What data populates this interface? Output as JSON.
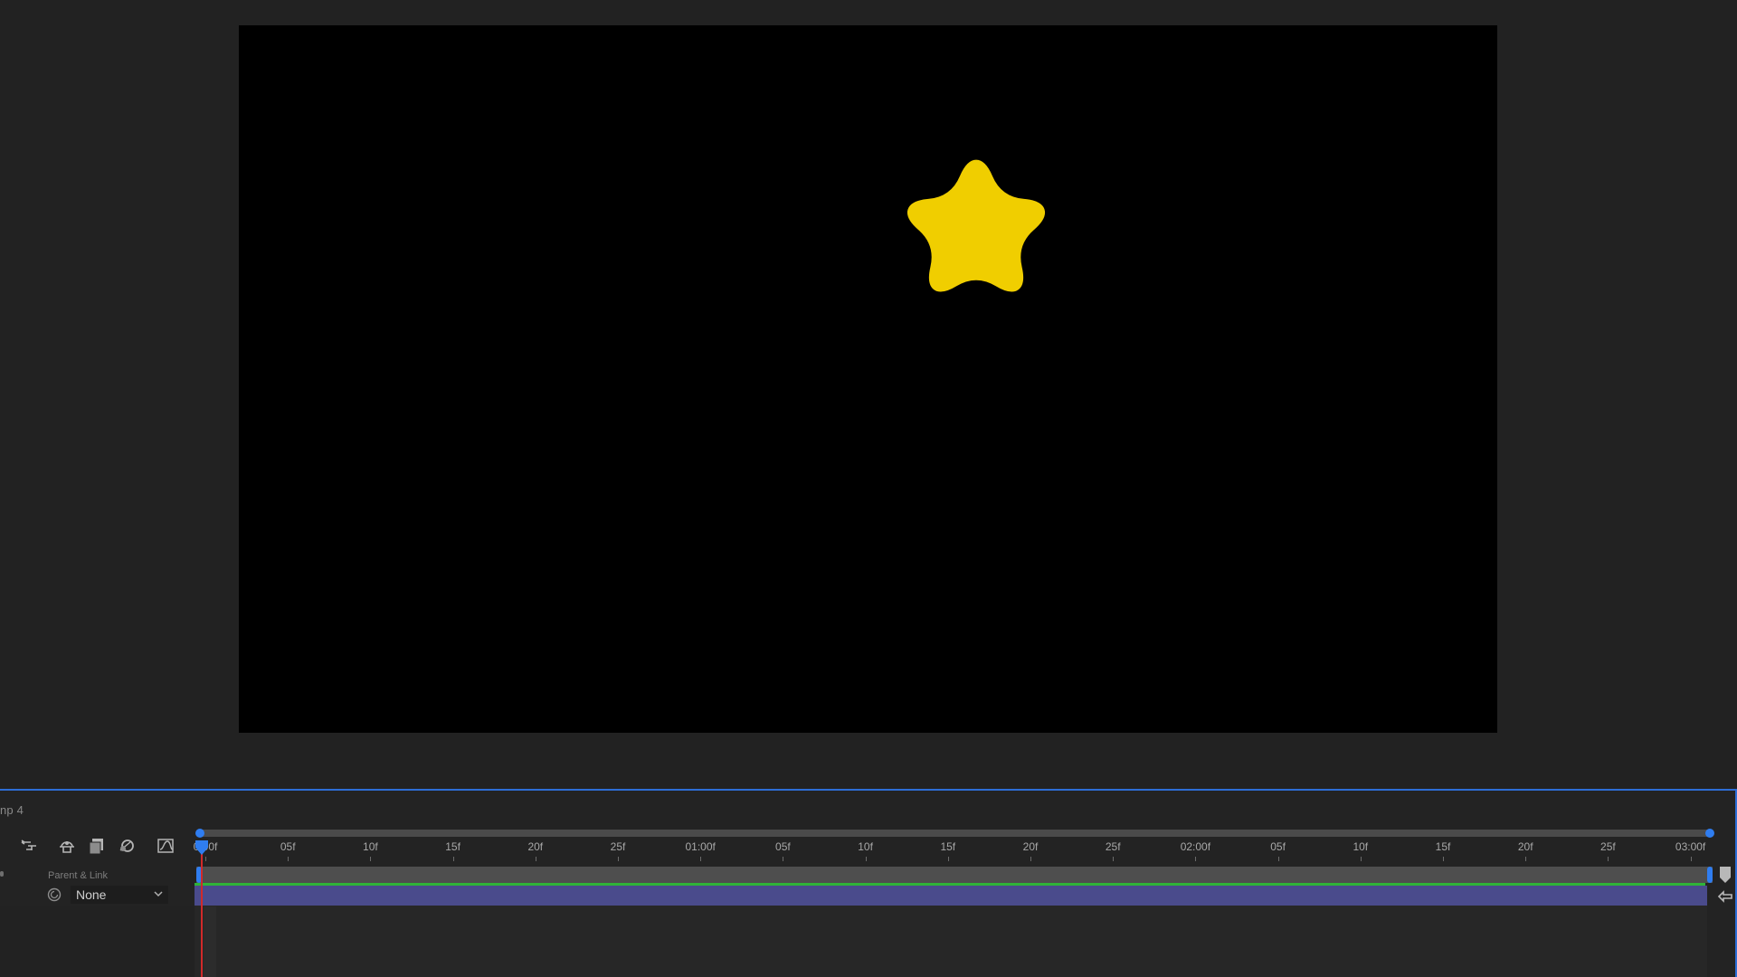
{
  "window": {
    "tab_title": "np 4"
  },
  "viewer": {
    "canvas_color": "#000000",
    "star_color": "#F0CE00"
  },
  "toolbar": {
    "icons": [
      "flowchart-icon",
      "shy-layers-icon",
      "frame-blending-icon",
      "motion-blur-icon",
      "graph-editor-icon"
    ]
  },
  "layer_columns": {
    "parent_link_header": "Parent & Link",
    "parent_value": "None"
  },
  "timeline": {
    "ticks": [
      "0:00f",
      "05f",
      "10f",
      "15f",
      "20f",
      "25f",
      "01:00f",
      "05f",
      "10f",
      "15f",
      "20f",
      "25f",
      "02:00f",
      "05f",
      "10f",
      "15f",
      "20f",
      "25f",
      "03:00f"
    ],
    "accent_color": "#2F7DF0",
    "layer_bar_color": "#4A4B8C",
    "label_line_color": "#2FB338",
    "cti_color": "#D22A2A"
  }
}
